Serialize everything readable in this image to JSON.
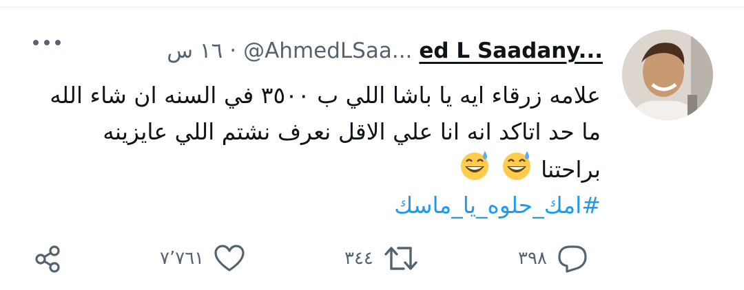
{
  "tweet": {
    "display_name": "ed L Saadany...",
    "handle": "@AhmedLSaa...",
    "separator": "·",
    "time": "١٦ س",
    "text_line1": "علامه زرقاء ايه يا باشا اللي ب ٣٥٠٠ في السنه ان شاء الله",
    "text_line2": "ما حد اتاكد انه انا علي الاقل نعرف نشتم اللي عايزينه",
    "text_line3": "براحتنا",
    "emoji": [
      "grinning-face-with-sweat",
      "grinning-face-with-sweat"
    ],
    "hashtag": "#امك_حلوه_يا_ماسك"
  },
  "actions": {
    "replies": "٣٩٨",
    "retweets": "٣٤٤",
    "likes": "٧٬٧٦١"
  },
  "icons": {
    "more": "more-horizontal-icon",
    "reply": "reply-icon",
    "retweet": "retweet-icon",
    "like": "heart-icon",
    "share": "share-icon"
  },
  "colors": {
    "text": "#0f1419",
    "secondary": "#536471",
    "link": "#1d9bf0"
  }
}
